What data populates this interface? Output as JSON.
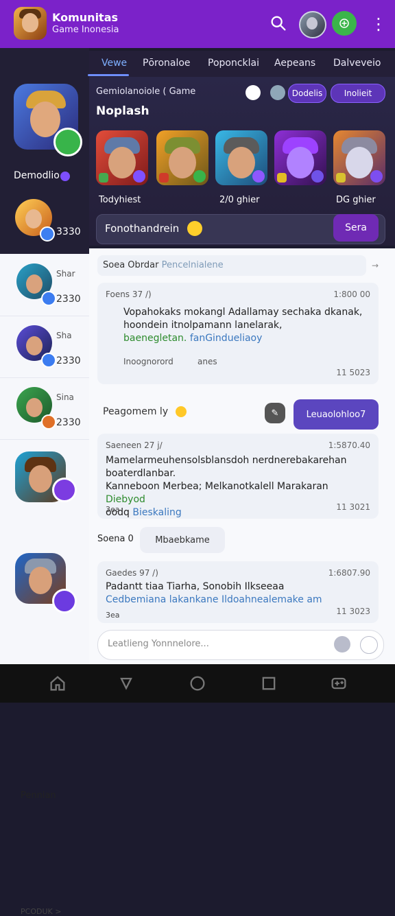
{
  "app": {
    "title": "Komunitas",
    "subtitle": "Game Inonesia"
  },
  "tabs": [
    {
      "label": "Vewe"
    },
    {
      "label": "Pōronaloe"
    },
    {
      "label": "Poponcklai"
    },
    {
      "label": "Aepeans"
    },
    {
      "label": "Dalveveio"
    }
  ],
  "hero": {
    "meta": "Gemiolanoiole ( Game",
    "title": "Noplash",
    "pill1": "Dodelis",
    "pill2": "Inolieit",
    "stats": [
      "Todyhiest",
      "2/0 ghier",
      "DG ghier"
    ],
    "search": "Fonothandrein",
    "search_button": "Sera"
  },
  "left_rail_top": {
    "name": "Demodlio",
    "score": "3330"
  },
  "left_rail": {
    "items": [
      {
        "name": "Shar",
        "score": "2330"
      },
      {
        "name": "Sha",
        "score": "2330"
      },
      {
        "name": "Sina",
        "score": "2330"
      }
    ],
    "section_label": "Pennian",
    "footer": "PCODUK >"
  },
  "chat": {
    "header": "Soea Obrdar",
    "header_sub": "Pencelnialene",
    "messages": [
      {
        "meta": "Foens 37 /)",
        "time": "1:800 00",
        "body_line1": "Vopahokaks mokangl Adallamay sechaka dkanak,",
        "body_line2": "hoondein itnolpamann lanelarak,",
        "body_line3a": "baenegletan.",
        "body_line3b": "fanGindueliaoy",
        "reply_meta": "Inoognorord",
        "reply_text": "anes",
        "footer_time": "11 5023"
      },
      {
        "meta": "Saeneen 27 j/",
        "time": "1:5870.40",
        "body_line1": "Mamelarmeuhensolsblansdoh nerdnerebakarehan",
        "body_line2": "boaterdlanbar.",
        "body_line3": "Kanneboon Merbea; Melkanotkalell Marakaran",
        "body_line3b": "Diebyod",
        "body_line4a": "oodq",
        "body_line4b": "Bieskaling",
        "footer_left": "3ea",
        "footer_time": "11 3021"
      },
      {
        "meta": "Gaedes 97 /)",
        "time": "1:6807.90",
        "body_line1": "Padantt tiaa Tiarha, Sonobih Ilkseeaa",
        "body_line2": "Cedbemiana lakankane Ildoahnealemake am",
        "footer_left": "3ea",
        "footer_time": "11 3023"
      }
    ],
    "reply_row": {
      "text": "Peagomem ly",
      "button": "Leuaolohloo7"
    },
    "chip": {
      "label": "Soena 0",
      "button": "Mbaebkame"
    },
    "input_placeholder": "Leatlieng Yonnnelore..."
  },
  "colors": {
    "topbar": "#7b22c9",
    "accent": "#6f2ab4",
    "blue_button": "#5b46bf",
    "green": "#3bb54a"
  },
  "icons": {
    "search": "search-icon",
    "menu": "kebab-menu-icon",
    "home": "home-icon",
    "back": "back-icon",
    "circle": "circle-icon",
    "square": "square-icon",
    "gamepad": "gamepad-icon"
  }
}
